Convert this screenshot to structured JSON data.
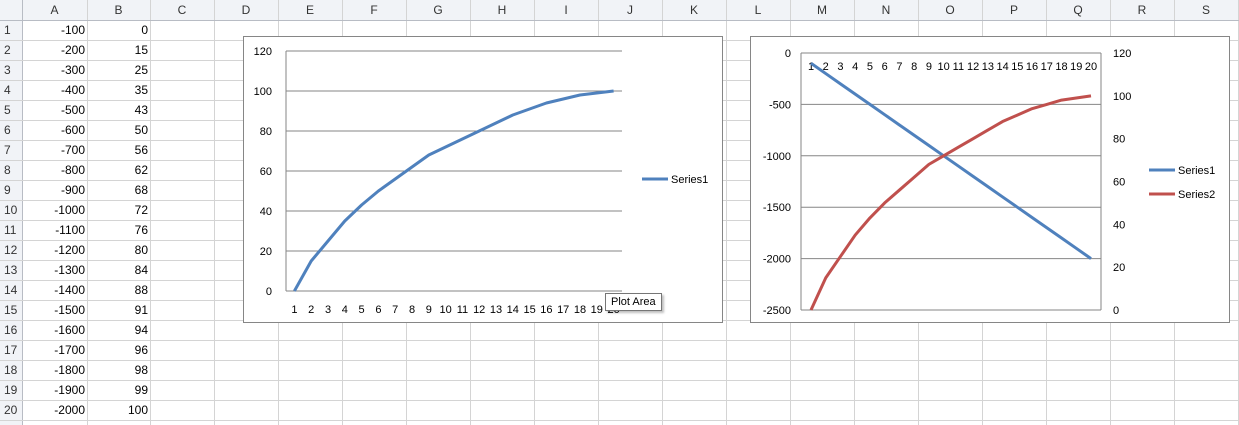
{
  "sheet": {
    "columns": [
      "A",
      "B",
      "C",
      "D",
      "E",
      "F",
      "G",
      "H",
      "I",
      "J",
      "K",
      "L",
      "M",
      "N",
      "O",
      "P",
      "Q",
      "R",
      "S"
    ],
    "rows": [
      [
        "-100",
        "0"
      ],
      [
        "-200",
        "15"
      ],
      [
        "-300",
        "25"
      ],
      [
        "-400",
        "35"
      ],
      [
        "-500",
        "43"
      ],
      [
        "-600",
        "50"
      ],
      [
        "-700",
        "56"
      ],
      [
        "-800",
        "62"
      ],
      [
        "-900",
        "68"
      ],
      [
        "-1000",
        "72"
      ],
      [
        "-1100",
        "76"
      ],
      [
        "-1200",
        "80"
      ],
      [
        "-1300",
        "84"
      ],
      [
        "-1400",
        "88"
      ],
      [
        "-1500",
        "91"
      ],
      [
        "-1600",
        "94"
      ],
      [
        "-1700",
        "96"
      ],
      [
        "-1800",
        "98"
      ],
      [
        "-1900",
        "99"
      ],
      [
        "-2000",
        "100"
      ]
    ]
  },
  "tooltip": {
    "text": "Plot Area"
  },
  "chart_data": [
    {
      "type": "line",
      "categories": [
        "1",
        "2",
        "3",
        "4",
        "5",
        "6",
        "7",
        "8",
        "9",
        "10",
        "11",
        "12",
        "13",
        "14",
        "15",
        "16",
        "17",
        "18",
        "19",
        "20"
      ],
      "series": [
        {
          "name": "Series1",
          "color": "#4F81BD",
          "values": [
            0,
            15,
            25,
            35,
            43,
            50,
            56,
            62,
            68,
            72,
            76,
            80,
            84,
            88,
            91,
            94,
            96,
            98,
            99,
            100
          ]
        }
      ],
      "ylim": [
        0,
        120
      ],
      "yticks": [
        "0",
        "20",
        "40",
        "60",
        "80",
        "100",
        "120"
      ],
      "grid": true,
      "legend": "right"
    },
    {
      "type": "line",
      "categories": [
        "1",
        "2",
        "3",
        "4",
        "5",
        "6",
        "7",
        "8",
        "9",
        "10",
        "11",
        "12",
        "13",
        "14",
        "15",
        "16",
        "17",
        "18",
        "19",
        "20"
      ],
      "series": [
        {
          "name": "Series1",
          "color": "#4F81BD",
          "axis": "primary",
          "values": [
            -100,
            -200,
            -300,
            -400,
            -500,
            -600,
            -700,
            -800,
            -900,
            -1000,
            -1100,
            -1200,
            -1300,
            -1400,
            -1500,
            -1600,
            -1700,
            -1800,
            -1900,
            -2000
          ]
        },
        {
          "name": "Series2",
          "color": "#C0504D",
          "axis": "secondary",
          "values": [
            0,
            15,
            25,
            35,
            43,
            50,
            56,
            62,
            68,
            72,
            76,
            80,
            84,
            88,
            91,
            94,
            96,
            98,
            99,
            100
          ]
        }
      ],
      "ylim": [
        -2500,
        0
      ],
      "yticks": [
        "0",
        "-500",
        "-1000",
        "-1500",
        "-2000",
        "-2500"
      ],
      "y2lim": [
        0,
        120
      ],
      "y2ticks": [
        "0",
        "20",
        "40",
        "60",
        "80",
        "100",
        "120"
      ],
      "grid": true,
      "legend": "right"
    }
  ]
}
